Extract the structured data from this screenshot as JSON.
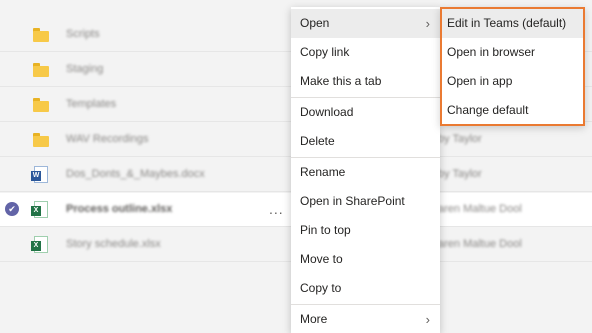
{
  "files": [
    {
      "name": "Scripts",
      "type": "folder",
      "modified_by": ""
    },
    {
      "name": "Staging",
      "type": "folder",
      "modified_by": ""
    },
    {
      "name": "Templates",
      "type": "folder",
      "modified_by": ""
    },
    {
      "name": "WAV Recordings",
      "type": "folder",
      "modified_by": "by Taylor"
    },
    {
      "name": "Dos_Donts_&_Maybes.docx",
      "type": "word",
      "modified_by": "by Taylor"
    },
    {
      "name": "Process outline.xlsx",
      "type": "excel",
      "modified_by": "aren Maltue Dool",
      "selected": true
    },
    {
      "name": "Story schedule.xlsx",
      "type": "excel",
      "modified_by": "aren Maltue Dool"
    }
  ],
  "row_actions": {
    "more_label": "..."
  },
  "context_menu": {
    "items": [
      {
        "label": "Open",
        "submenu": true
      },
      {
        "label": "Copy link"
      },
      {
        "label": "Make this a tab"
      },
      {
        "label": "Download"
      },
      {
        "label": "Delete"
      },
      {
        "label": "Rename"
      },
      {
        "label": "Open in SharePoint"
      },
      {
        "label": "Pin to top"
      },
      {
        "label": "Move to"
      },
      {
        "label": "Copy to"
      },
      {
        "label": "More",
        "submenu": true
      }
    ],
    "chevron": "›"
  },
  "open_submenu": {
    "items": [
      {
        "label": "Edit in Teams (default)"
      },
      {
        "label": "Open in browser"
      },
      {
        "label": "Open in app"
      },
      {
        "label": "Change default"
      }
    ],
    "highlight_color": "#ea7a32"
  },
  "icons": {
    "check": "✔",
    "word_badge": "W",
    "excel_badge": "X"
  }
}
